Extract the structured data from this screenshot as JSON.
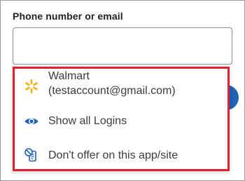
{
  "form": {
    "field_label": "Phone number or email",
    "field_value": ""
  },
  "autofill": {
    "suggestion": {
      "label": "Walmart (testaccount@gmail.com)",
      "icon": "walmart-spark-icon"
    },
    "show_all": {
      "label": "Show all Logins",
      "icon": "eye-icon"
    },
    "never": {
      "label": "Don't offer on this app/site",
      "icon": "no-autofill-icon"
    }
  },
  "colors": {
    "highlight_border": "#e0222f",
    "walmart_spark": "#f2b21f",
    "icon_blue": "#1f63b6",
    "button_blue": "#1f63b6"
  }
}
